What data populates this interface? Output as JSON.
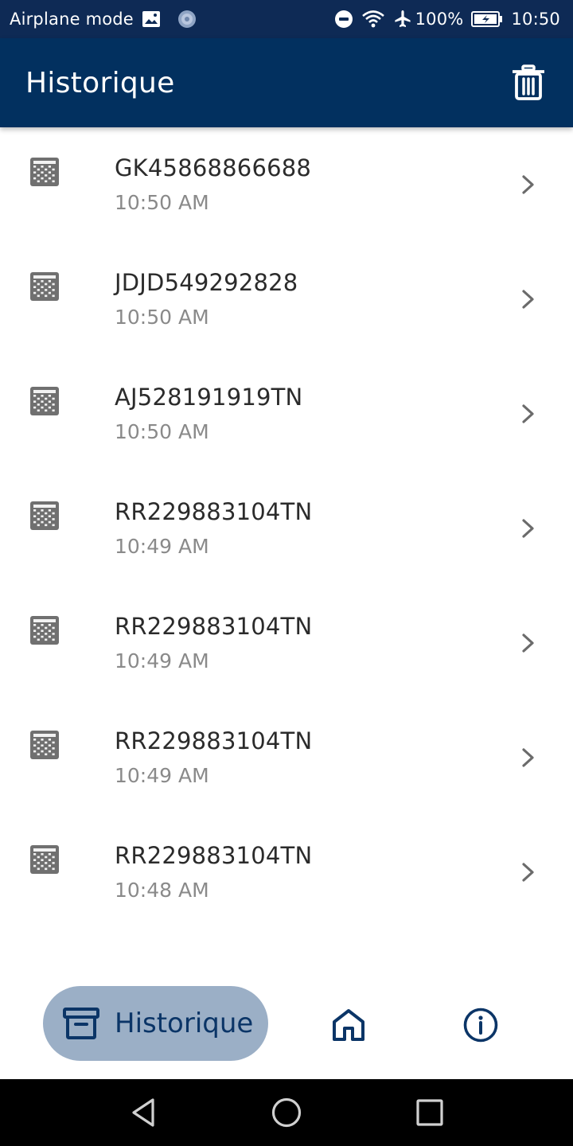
{
  "status_bar": {
    "left_text": "Airplane mode",
    "battery": "100%",
    "time": "10:50",
    "icons": [
      "image-icon",
      "sync-icon",
      "dnd-icon",
      "wifi-icon",
      "airplane-icon",
      "battery-icon"
    ]
  },
  "app_bar": {
    "title": "Historique",
    "action_icon": "trash-icon"
  },
  "history": [
    {
      "code": "GK45868866688",
      "time": "10:50 AM"
    },
    {
      "code": "JDJD549292828",
      "time": "10:50 AM"
    },
    {
      "code": "AJ528191919TN",
      "time": "10:50 AM"
    },
    {
      "code": "RR229883104TN",
      "time": "10:49 AM"
    },
    {
      "code": "RR229883104TN",
      "time": "10:49 AM"
    },
    {
      "code": "RR229883104TN",
      "time": "10:49 AM"
    },
    {
      "code": "RR229883104TN",
      "time": "10:48 AM"
    }
  ],
  "bottom_nav": {
    "active_label": "Historique",
    "items": [
      "archive-icon",
      "home-icon",
      "info-icon"
    ]
  },
  "colors": {
    "status_bar_bg": "#0e2a55",
    "app_bar_bg": "#02305f",
    "nav_active_bg": "#9bafc6",
    "nav_icon": "#0b3567",
    "primary_text": "#2b2b2b",
    "secondary_text": "#8a8a8a"
  }
}
